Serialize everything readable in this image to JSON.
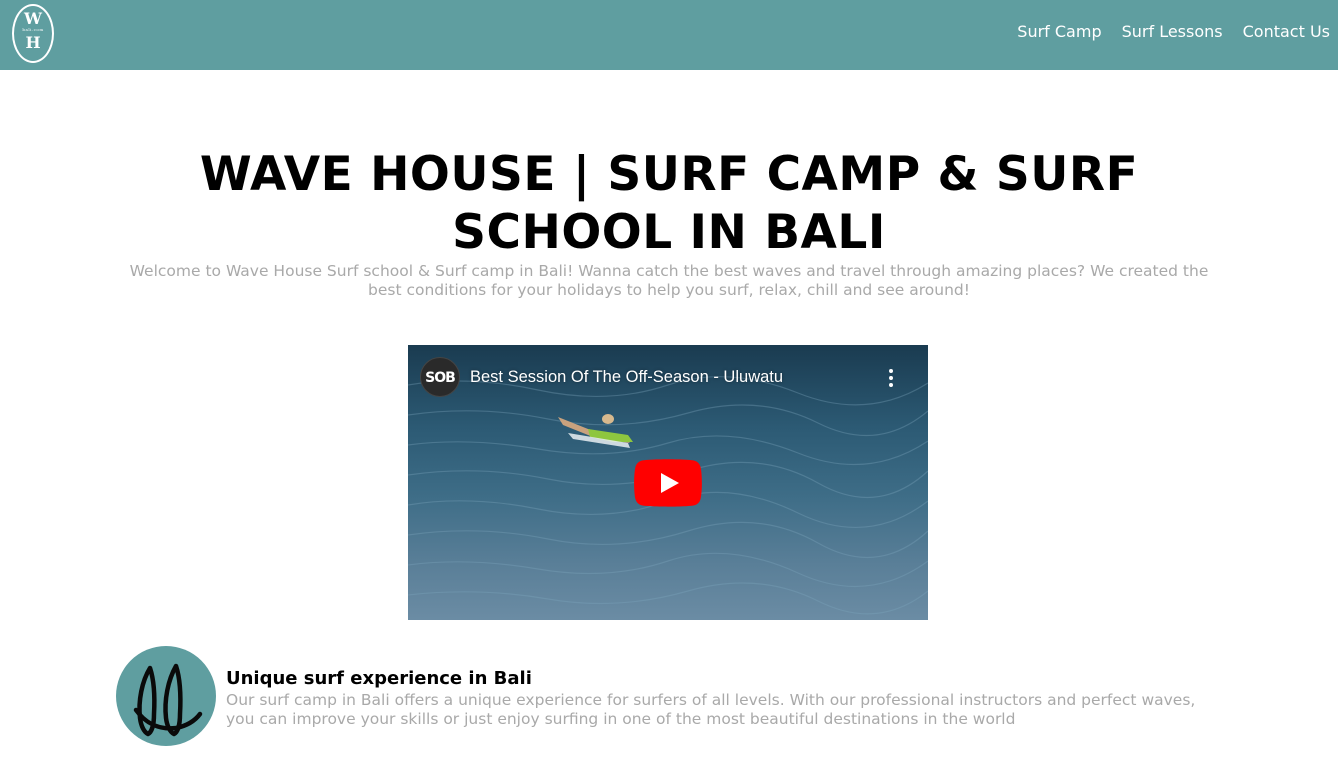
{
  "header": {
    "logo": {
      "top_letter": "W",
      "tagline": "bali.com",
      "bottom_letter": "H"
    },
    "nav": [
      {
        "label": "Surf Camp"
      },
      {
        "label": "Surf Lessons"
      },
      {
        "label": "Contact Us"
      }
    ],
    "background_color": "#5f9ea0"
  },
  "hero": {
    "title": "WAVE HOUSE | SURF CAMP & SURF SCHOOL IN BALI",
    "subtitle": "Welcome to Wave House Surf school & Surf camp in Bali! Wanna catch the best waves and travel through amazing places? We created the best conditions for your holidays to help you surf, relax, chill and see around!"
  },
  "video": {
    "channel_avatar": "SOB",
    "title": "Best Session Of The Off-Season - Uluwatu",
    "play_icon": "youtube-play-icon",
    "menu_icon": "more-vert-icon",
    "play_color": "#ff0000"
  },
  "feature": {
    "icon": "surfboards-icon",
    "title": "Unique surf experience in Bali",
    "text": "Our surf camp in Bali offers a unique experience for surfers of all levels. With our professional instructors and perfect waves, you can improve your skills or just enjoy surfing in one of the most beautiful destinations in the world"
  }
}
